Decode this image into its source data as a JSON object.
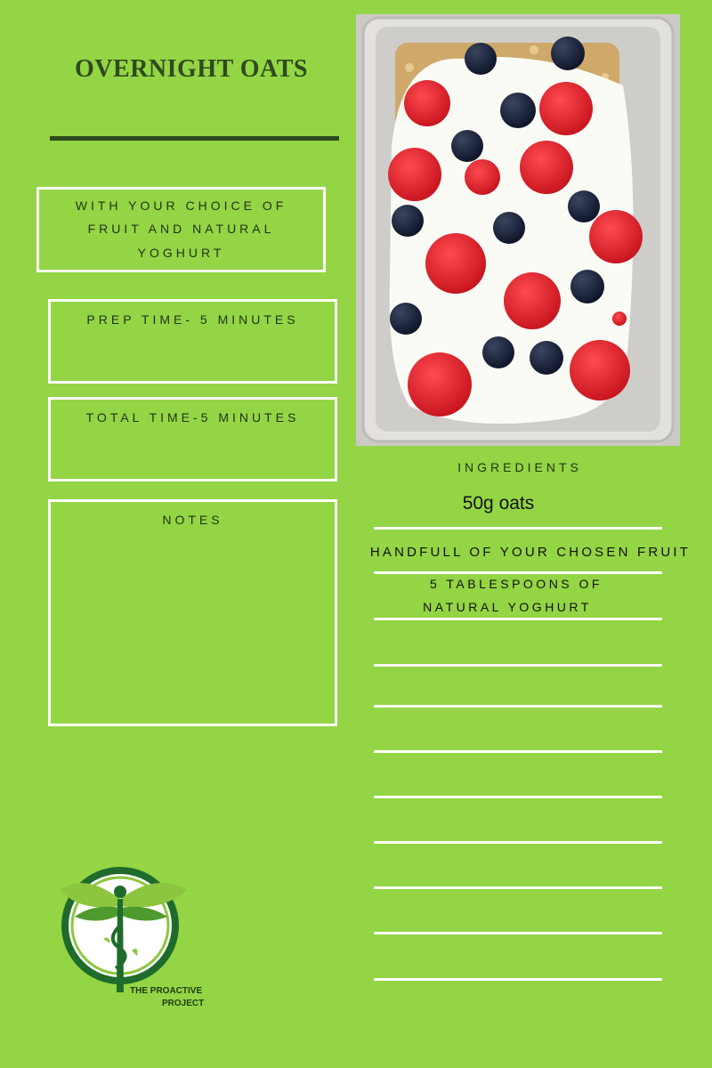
{
  "card": {
    "title": "OVERNIGHT OATS",
    "subtitle_line1": "WITH YOUR CHOICE OF",
    "subtitle_line2": "FRUIT AND NATURAL",
    "subtitle_line3": "YOGHURT",
    "prep_time": "PREP TIME- 5 MINUTES",
    "total_time": "TOTAL TIME-5 MINUTES",
    "notes_label": "NOTES"
  },
  "ingredients": {
    "heading": "INGREDIENTS",
    "item1": "50g oats",
    "item2": "HANDFULL OF YOUR CHOSEN FRUIT",
    "item3_line1": "5 TABLESPOONS OF",
    "item3_line2": "NATURAL YOGHURT"
  },
  "logo": {
    "line1": "THE PROACTIVE",
    "line2": "PROJECT"
  },
  "colors": {
    "background": "#93d544",
    "title": "#2f4a1e",
    "box_border": "#ffffff"
  }
}
